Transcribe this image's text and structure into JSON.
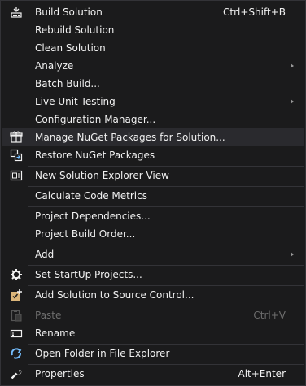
{
  "menu": {
    "items": [
      {
        "label": "Build Solution",
        "shortcut": "Ctrl+Shift+B",
        "icon": "build-icon"
      },
      {
        "label": "Rebuild Solution"
      },
      {
        "label": "Clean Solution"
      },
      {
        "label": "Analyze",
        "submenu": true
      },
      {
        "label": "Batch Build..."
      },
      {
        "label": "Live Unit Testing",
        "submenu": true
      },
      {
        "label": "Configuration Manager..."
      },
      {
        "label": "Manage NuGet Packages for Solution...",
        "icon": "nuget-package-icon"
      },
      {
        "label": "Restore NuGet Packages",
        "icon": "restore-packages-icon"
      },
      {
        "label": "New Solution Explorer View",
        "icon": "solution-explorer-view-icon"
      },
      {
        "label": "Calculate Code Metrics"
      },
      {
        "label": "Project Dependencies..."
      },
      {
        "label": "Project Build Order..."
      },
      {
        "label": "Add",
        "submenu": true
      },
      {
        "label": "Set StartUp Projects...",
        "icon": "gear-icon"
      },
      {
        "label": "Add Solution to Source Control...",
        "icon": "source-control-icon"
      },
      {
        "label": "Paste",
        "shortcut": "Ctrl+V",
        "icon": "paste-icon",
        "disabled": true
      },
      {
        "label": "Rename",
        "icon": "rename-icon"
      },
      {
        "label": "Open Folder in File Explorer",
        "icon": "refresh-arrow-icon"
      },
      {
        "label": "Properties",
        "shortcut": "Alt+Enter",
        "icon": "wrench-icon"
      }
    ]
  },
  "colors": {
    "background": "#1b1b1c",
    "text": "#f1f1f1",
    "disabled_text": "#6d6d6d",
    "hover": "#2a2a2e",
    "separator": "#333337",
    "icon_blue": "#75beff",
    "icon_yellow": "#dcb67a"
  }
}
